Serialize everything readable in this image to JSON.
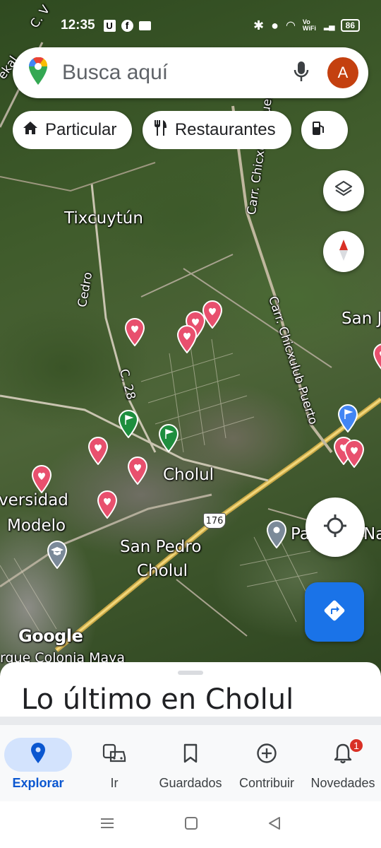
{
  "status_bar": {
    "time": "12:35",
    "battery": "86",
    "network": "Vo WiFi"
  },
  "search": {
    "placeholder": "Busca aquí",
    "avatar_letter": "A"
  },
  "chips": [
    {
      "label": "Particular",
      "icon": "home-icon"
    },
    {
      "label": "Restaurantes",
      "icon": "restaurant-icon"
    },
    {
      "label": "",
      "icon": "gas-station-icon"
    }
  ],
  "map": {
    "labels": {
      "tixcuytun": "Tixcuytún",
      "cedro": "Cedro",
      "c28": "C. 28",
      "carr_chicxulub_upper": "Carr. Chicxulub Puerto",
      "carr_chicxulub_lower": "Carr. Chicxulub Puerto",
      "san_j": "San J",
      "cholul": "Cholul",
      "universidad": "versidad",
      "modelo": "Modelo",
      "san_pedro": "San Pedro",
      "cholul2": "Cholul",
      "highway": "176",
      "pa_nat": "Pa",
      "nat": "Nat",
      "google": "Google",
      "colonia": "rque Colonia Maya",
      "top_left_road": "C. V",
      "kal": "ekal"
    }
  },
  "sheet": {
    "title": "Lo último en Cholul"
  },
  "bottom_nav": [
    {
      "label": "Explorar",
      "icon": "explore-pin-icon",
      "active": true
    },
    {
      "label": "Ir",
      "icon": "commute-icon",
      "active": false
    },
    {
      "label": "Guardados",
      "icon": "bookmark-icon",
      "active": false
    },
    {
      "label": "Contribuir",
      "icon": "add-circle-icon",
      "active": false
    },
    {
      "label": "Novedades",
      "icon": "bell-icon",
      "active": false,
      "badge": "1"
    }
  ],
  "colors": {
    "accent": "#1a73e8",
    "avatar": "#c4400f",
    "heart_pin": "#e8506e",
    "flag_pin": "#1e8e3e"
  }
}
